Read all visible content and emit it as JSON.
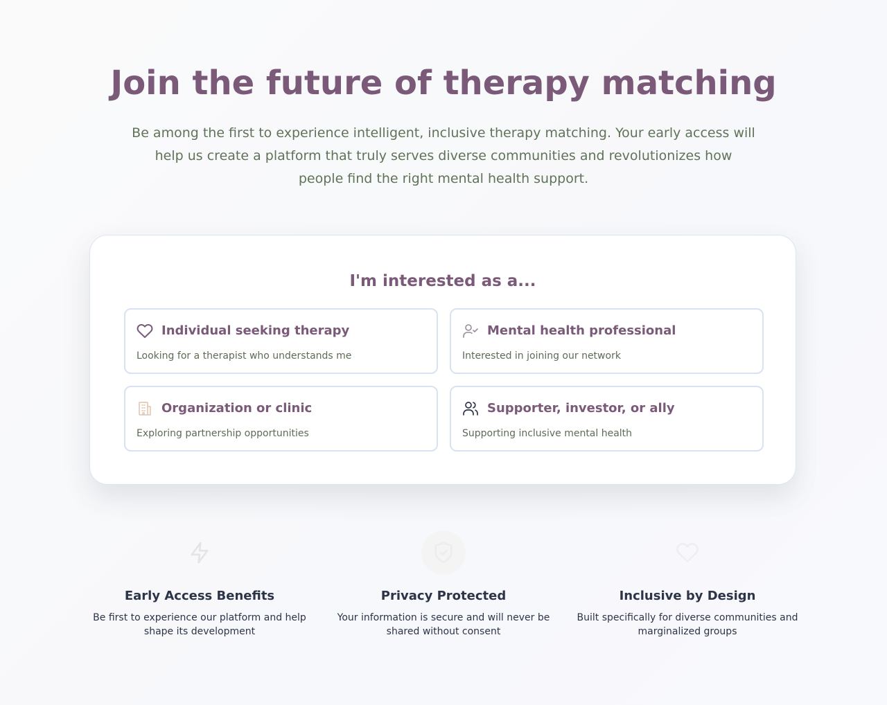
{
  "hero": {
    "title": "Join the future of therapy matching",
    "subtitle": "Be among the first to experience intelligent, inclusive therapy matching. Your early access will help us create a platform that truly serves diverse communities and revolutionizes how people find the right mental health support."
  },
  "interest": {
    "heading": "I'm interested as a...",
    "options": [
      {
        "icon": "heart-icon",
        "title": "Individual seeking therapy",
        "description": "Looking for a therapist who understands me"
      },
      {
        "icon": "user-check-icon",
        "title": "Mental health professional",
        "description": "Interested in joining our network"
      },
      {
        "icon": "building-icon",
        "title": "Organization or clinic",
        "description": "Exploring partnership opportunities"
      },
      {
        "icon": "users-icon",
        "title": "Supporter, investor, or ally",
        "description": "Supporting inclusive mental health"
      }
    ]
  },
  "features": [
    {
      "icon": "lightning-icon",
      "title": "Early Access Benefits",
      "description": "Be first to experience our platform and help shape its development"
    },
    {
      "icon": "shield-icon",
      "title": "Privacy Protected",
      "description": "Your information is secure and will never be shared without consent"
    },
    {
      "icon": "heart-icon",
      "title": "Inclusive by Design",
      "description": "Built specifically for diverse communities and marginalized groups"
    }
  ],
  "colors": {
    "accent_purple": "#7a5a78",
    "subtitle_green": "#5f7358",
    "card_border": "#d7e2f2",
    "dark_text": "#2c3448"
  }
}
